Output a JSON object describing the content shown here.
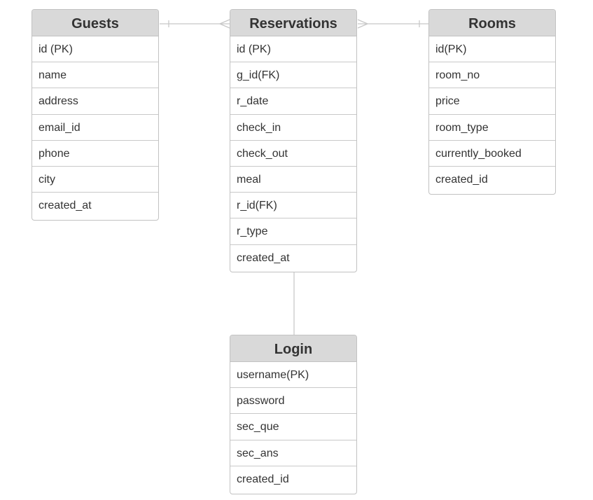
{
  "entities": {
    "guests": {
      "title": "Guests",
      "fields": [
        "id (PK)",
        "name",
        "address",
        "email_id",
        "phone",
        "city",
        "created_at"
      ]
    },
    "reservations": {
      "title": "Reservations",
      "fields": [
        "id (PK)",
        "g_id(FK)",
        "r_date",
        "check_in",
        "check_out",
        "meal",
        "r_id(FK)",
        "r_type",
        "created_at"
      ]
    },
    "rooms": {
      "title": "Rooms",
      "fields": [
        "id(PK)",
        "room_no",
        "price",
        "room_type",
        "currently_booked",
        "created_id"
      ]
    },
    "login": {
      "title": "Login",
      "fields": [
        "username(PK)",
        "password",
        "sec_que",
        "sec_ans",
        "created_id"
      ]
    }
  },
  "relationships": [
    {
      "from": "guests",
      "to": "reservations",
      "from_cardinality": "one",
      "to_cardinality": "many"
    },
    {
      "from": "reservations",
      "to": "rooms",
      "from_cardinality": "many",
      "to_cardinality": "one"
    },
    {
      "from": "reservations",
      "to": "login",
      "from_cardinality": "none",
      "to_cardinality": "none"
    }
  ],
  "colors": {
    "header_bg": "#d9d9d9",
    "border": "#c2c2c2",
    "connector": "#c8c8c8",
    "text": "#333333"
  }
}
